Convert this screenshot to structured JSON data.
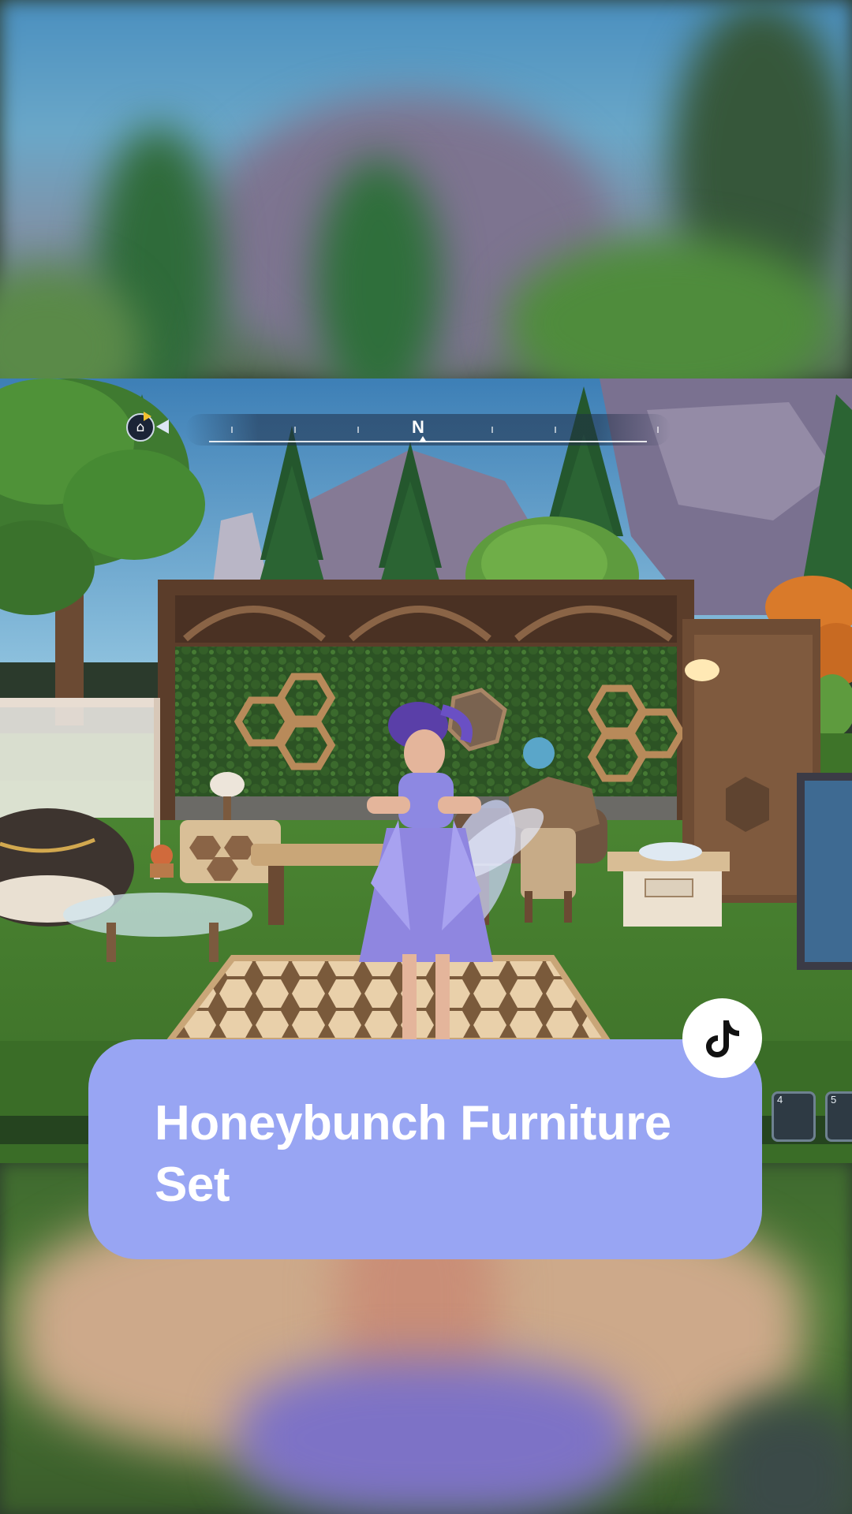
{
  "caption": {
    "title": "Honeybunch Furniture Set",
    "background_color": "#98a5f3",
    "text_color": "#ffffff"
  },
  "badge": {
    "icon": "tiktok-logo-icon"
  },
  "hud": {
    "compass_heading": "N",
    "home_marker_icon": "house-icon",
    "hotbar_slots": [
      "4",
      "5"
    ]
  }
}
